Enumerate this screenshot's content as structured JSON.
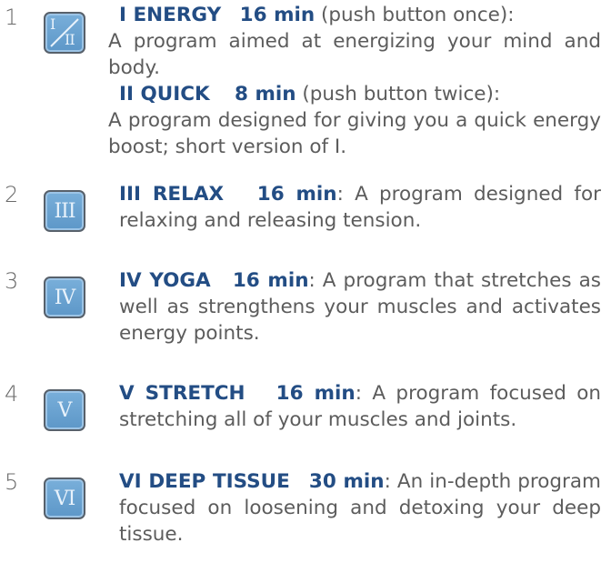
{
  "programs": [
    {
      "number": "1",
      "button_glyph_top": "I",
      "button_glyph_bottom": "II",
      "title_a": "I ENERGY",
      "time_a": "16 min",
      "note_a": " (push button once):",
      "desc_a": "A program aimed at energizing your mind and body.",
      "title_b": "II QUICK",
      "time_b": "8 min",
      "note_b": " (push button twice):",
      "desc_b": "A program designed for giving you a quick energy boost; short version of I."
    },
    {
      "number": "2",
      "button_glyph": "III",
      "title": "III RELAX",
      "time": "16 min",
      "desc": ": A program designed for relaxing and releasing tension."
    },
    {
      "number": "3",
      "button_glyph": "IV",
      "title": "IV YOGA",
      "time": "16 min",
      "desc": ": A program that stretches as well as strengthens your muscles and activates energy points."
    },
    {
      "number": "4",
      "button_glyph": "V",
      "title": "V STRETCH",
      "time": "16 min",
      "desc": ": A program focused on stretching all of your muscles and joints."
    },
    {
      "number": "5",
      "button_glyph": "VI",
      "title": "VI DEEP TISSUE",
      "time": "30 min",
      "desc": ": An in-depth program focused on loosening and detoxing your deep tissue."
    }
  ],
  "colors": {
    "accent": "#234d84",
    "button_fill": "#6aa3d1",
    "body_text": "#5c5c5c"
  },
  "icons": [
    "roman-numeral-button-icon"
  ]
}
